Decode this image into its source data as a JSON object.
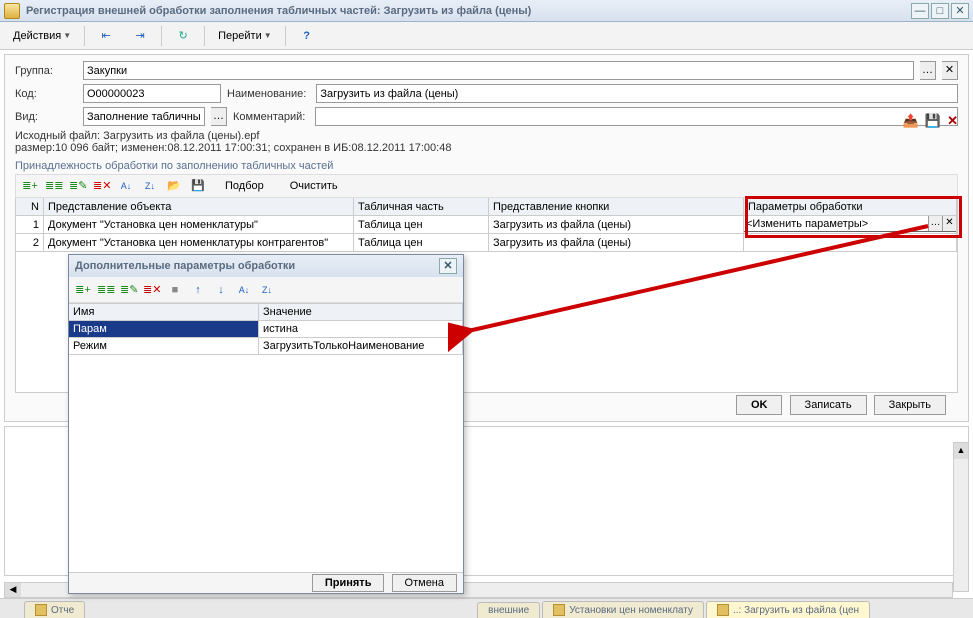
{
  "window": {
    "title": "Регистрация внешней обработки заполнения табличных частей: Загрузить из файла (цены)"
  },
  "toolbar": {
    "actions": "Действия",
    "goto": "Перейти"
  },
  "form": {
    "group_label": "Группа:",
    "group_value": "Закупки",
    "code_label": "Код:",
    "code_value": "О00000023",
    "name_label": "Наименование:",
    "name_value": "Загрузить из файла (цены)",
    "kind_label": "Вид:",
    "kind_value": "Заполнение табличных ч...",
    "comment_label": "Комментарий:",
    "comment_value": "",
    "file_line1": "Исходный файл: Загрузить из файла (цены).epf",
    "file_line2": "размер:10 096 байт; изменен:08.12.2011 17:00:31; сохранен в ИБ:08.12.2011 17:00:48"
  },
  "section": {
    "title": "Принадлежность обработки по заполнению табличных частей",
    "toolbar": {
      "select": "Подбор",
      "clear": "Очистить"
    },
    "columns": {
      "n": "N",
      "obj": "Представление объекта",
      "tab": "Табличная часть",
      "btn": "Представление кнопки",
      "par": "Параметры обработки"
    },
    "rows": [
      {
        "n": "1",
        "obj": "Документ \"Установка цен номенклатуры\"",
        "tab": "Таблица цен",
        "btn": "Загрузить из файла (цены)",
        "par": "<Изменить параметры>"
      },
      {
        "n": "2",
        "obj": "Документ \"Установка цен номенклатуры контрагентов\"",
        "tab": "Таблица цен",
        "btn": "Загрузить из файла (цены)",
        "par": ""
      }
    ]
  },
  "footer": {
    "ok": "OK",
    "save": "Записать",
    "close": "Закрыть"
  },
  "dialog": {
    "title": "Дополнительные параметры обработки",
    "columns": {
      "name": "Имя",
      "value": "Значение"
    },
    "rows": [
      {
        "name": "Парам",
        "value": "истина"
      },
      {
        "name": "Режим",
        "value": "ЗагрузитьТолькоНаименование"
      }
    ],
    "accept": "Принять",
    "cancel": "Отмена"
  },
  "tabs": {
    "t1": "Отче",
    "t2": "внешние",
    "t3": "Установки цен номенклату",
    "t4": "..: Загрузить из файла (цен"
  }
}
